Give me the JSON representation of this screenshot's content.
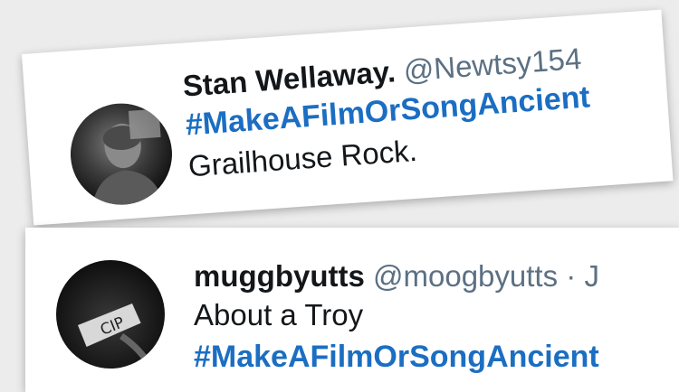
{
  "tweets": [
    {
      "display_name": "Stan Wellaway.",
      "handle": "@Newtsy154",
      "hashtag": "#MakeAFilmOrSongAncient",
      "text": "Grailhouse Rock.",
      "avatar_icon": "user-avatar-photo"
    },
    {
      "display_name": "muggbyutts",
      "handle": "@moogbyutts",
      "separator": "·",
      "date_fragment": "J",
      "text": "About a Troy",
      "hashtag": "#MakeAFilmOrSongAncient",
      "avatar_icon": "user-avatar-photo"
    }
  ],
  "colors": {
    "hashtag": "#1b6ec2",
    "handle": "#5b7083",
    "name": "#14171a"
  }
}
